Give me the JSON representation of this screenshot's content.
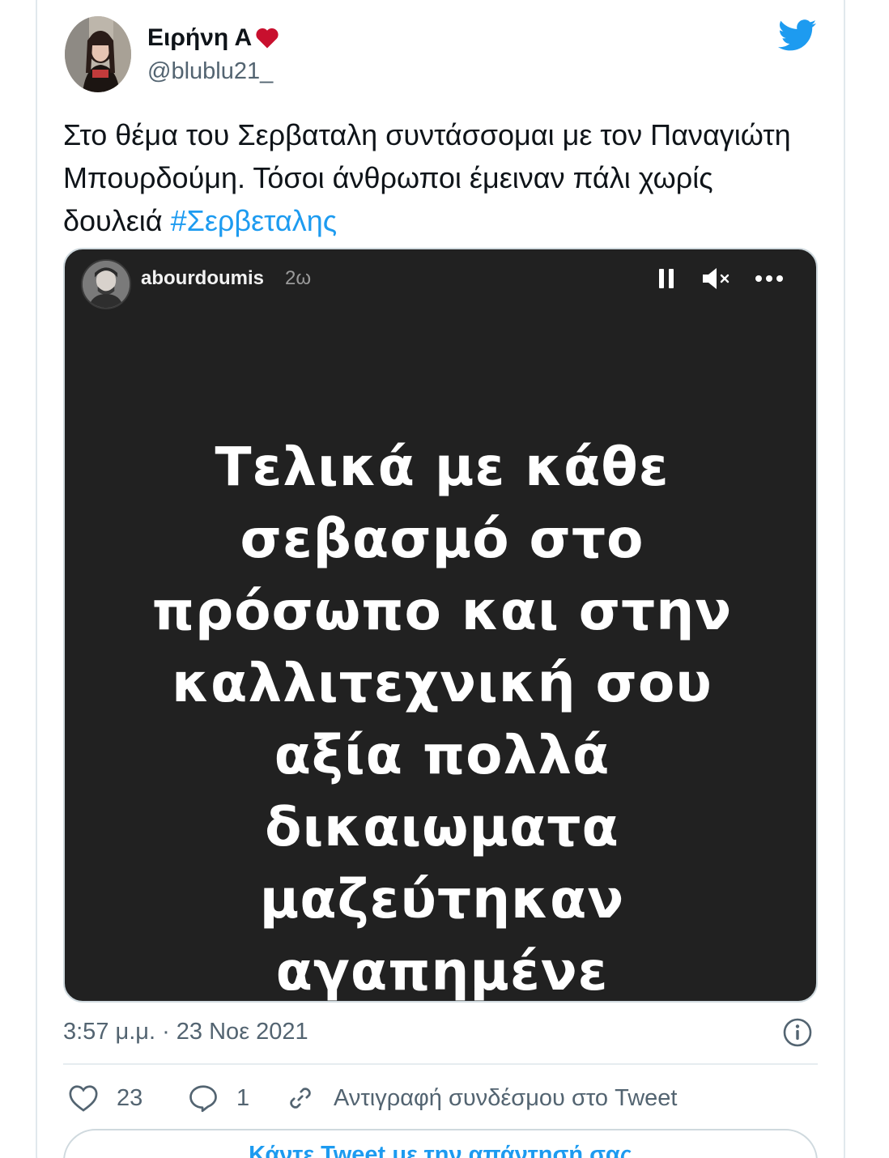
{
  "author": {
    "display_name": "Ειρήνη Α",
    "handle": "@blublu21_"
  },
  "tweet": {
    "text": "Στο θέμα του Σερβαταλη συντάσσομαι με τον Παναγιώτη Μπουρδούμη. Τόσοι άνθρωποι έμειναν πάλι χωρίς δουλειά ",
    "hashtag": "#Σερβεταλης",
    "timestamp": "3:57 μ.μ. · 23 Νοε 2021"
  },
  "story": {
    "username": "abourdoumis",
    "time_ago": "2ω",
    "text": "Τελικά με κάθε σεβασμό στο πρόσωπο και στην καλλιτεχνική σου αξία πολλά δικαιωματα μαζεύτηκαν αγαπημένε",
    "lines": [
      "Τελικά με κάθε",
      "σεβασμό στο",
      "πρόσωπο και στην",
      "καλλιτεχνική σου",
      "αξία πολλά",
      "δικαιωματα",
      "μαζεύτηκαν",
      "αγαπημένε"
    ]
  },
  "actions": {
    "likes": "23",
    "replies": "1",
    "copy_link": "Αντιγραφή συνδέσμου στο Tweet"
  },
  "reply_button": "Κάντε Tweet με την απάντησή σας",
  "colors": {
    "accent": "#1d9bf0",
    "heart": "#e0245e",
    "secondary_text": "#536471",
    "story_bg": "#212121"
  },
  "icons": [
    "heart-icon",
    "twitter-logo-icon",
    "pause-icon",
    "mute-icon",
    "more-icon",
    "info-icon",
    "like-icon",
    "reply-icon",
    "link-icon"
  ]
}
